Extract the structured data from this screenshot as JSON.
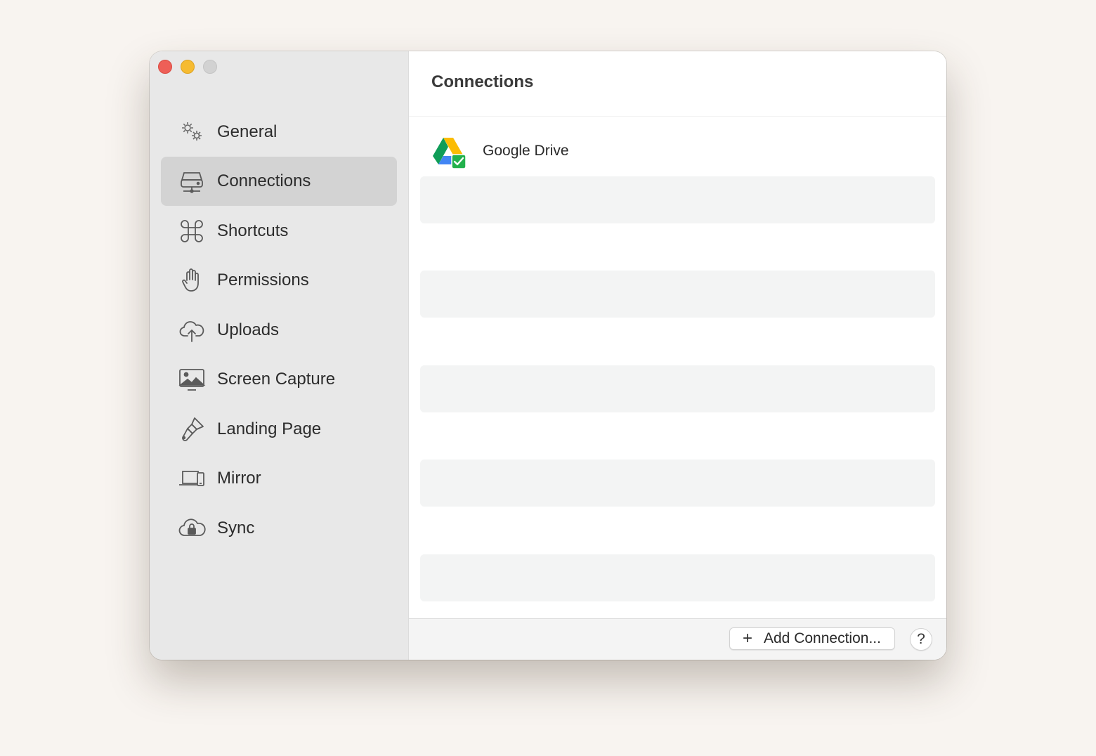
{
  "window": {
    "traffic_lights": [
      "close",
      "minimize",
      "zoom"
    ]
  },
  "sidebar": {
    "items": [
      {
        "label": "General",
        "icon": "gears-icon",
        "active": false
      },
      {
        "label": "Connections",
        "icon": "server-icon",
        "active": true
      },
      {
        "label": "Shortcuts",
        "icon": "command-icon",
        "active": false
      },
      {
        "label": "Permissions",
        "icon": "hand-icon",
        "active": false
      },
      {
        "label": "Uploads",
        "icon": "cloud-upload-icon",
        "active": false
      },
      {
        "label": "Screen Capture",
        "icon": "screen-image-icon",
        "active": false
      },
      {
        "label": "Landing Page",
        "icon": "paintbrush-icon",
        "active": false
      },
      {
        "label": "Mirror",
        "icon": "laptop-phone-icon",
        "active": false
      },
      {
        "label": "Sync",
        "icon": "cloud-lock-icon",
        "active": false
      }
    ]
  },
  "main": {
    "title": "Connections",
    "connections": [
      {
        "label": "Google Drive",
        "icon": "google-drive-icon",
        "status": "connected"
      }
    ]
  },
  "footer": {
    "add_button_label": "Add Connection...",
    "help_label": "?"
  },
  "colors": {
    "close": "#ee5f57",
    "minimize": "#f6bb31",
    "zoom": "#d2d2d2",
    "sidebar_bg": "#e8e8e8",
    "active_item_bg": "#d3d3d3",
    "stripe": "#f3f4f4",
    "page_bg": "#f8f4f0"
  }
}
